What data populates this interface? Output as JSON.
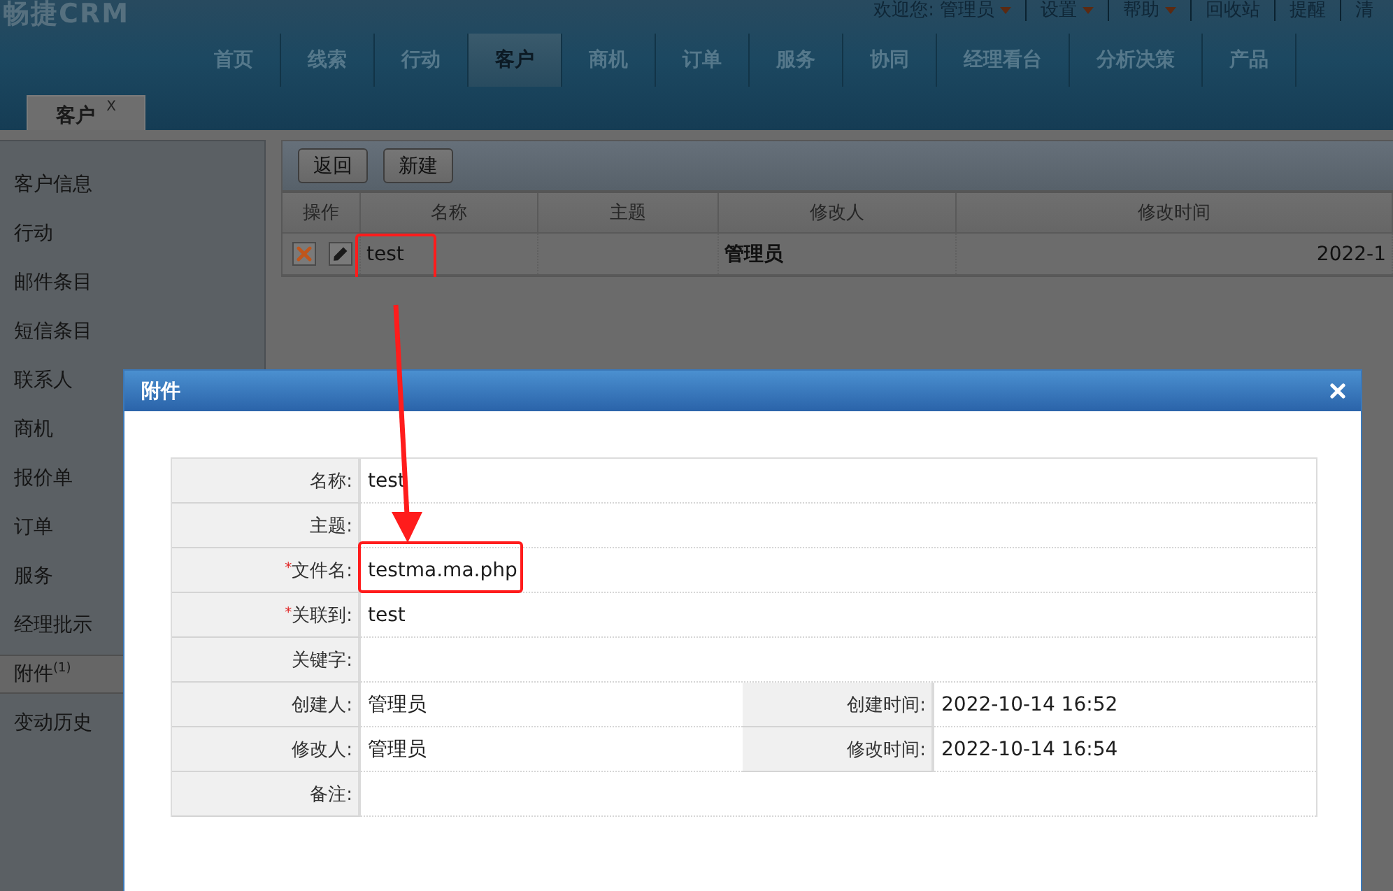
{
  "header": {
    "logo": "畅捷CRM",
    "welcome": "欢迎您:",
    "links": [
      {
        "label": "管理员",
        "dropdown": true
      },
      {
        "label": "设置",
        "dropdown": true
      },
      {
        "label": "帮助",
        "dropdown": true
      },
      {
        "label": "回收站",
        "dropdown": false
      },
      {
        "label": "提醒",
        "dropdown": false
      },
      {
        "label": "清",
        "dropdown": false
      }
    ]
  },
  "nav": [
    {
      "label": "首页",
      "selected": false
    },
    {
      "label": "线索",
      "selected": false
    },
    {
      "label": "行动",
      "selected": false
    },
    {
      "label": "客户",
      "selected": true
    },
    {
      "label": "商机",
      "selected": false
    },
    {
      "label": "订单",
      "selected": false
    },
    {
      "label": "服务",
      "selected": false
    },
    {
      "label": "协同",
      "selected": false
    },
    {
      "label": "经理看台",
      "selected": false
    },
    {
      "label": "分析决策",
      "selected": false
    },
    {
      "label": "产品",
      "selected": false
    }
  ],
  "page_tabs": [
    {
      "label": "客户",
      "close": "X",
      "selected": true
    }
  ],
  "sidebar": {
    "items": [
      {
        "label": "客户信息",
        "selected": false
      },
      {
        "label": "行动",
        "selected": false
      },
      {
        "label": "邮件条目",
        "selected": false
      },
      {
        "label": "短信条目",
        "selected": false
      },
      {
        "label": "联系人",
        "selected": false
      },
      {
        "label": "商机",
        "selected": false
      },
      {
        "label": "报价单",
        "selected": false
      },
      {
        "label": "订单",
        "selected": false
      },
      {
        "label": "服务",
        "selected": false
      },
      {
        "label": "经理批示",
        "selected": false
      },
      {
        "label": "附件$^{(1)}$",
        "selected": true
      },
      {
        "label": "变动历史",
        "selected": false
      }
    ]
  },
  "toolbar": {
    "buttons": [
      "返回",
      "新建"
    ]
  },
  "table": {
    "columns": [
      "操作",
      "名称",
      "主题",
      "修改人",
      "修改时间"
    ],
    "rows": [
      {
        "actions": [
          {
            "kind": "delete"
          },
          {
            "kind": "edit"
          }
        ],
        "name": "test",
        "name_highlighted": true,
        "modifier": "管理员",
        "modified_time": "2022-1"
      }
    ]
  },
  "dialog": {
    "title": "附件",
    "fields": [
      {
        "label": "名称:",
        "value": "test",
        "highlighted": false
      },
      {
        "label": "主题:",
        "highlighted": false
      },
      {
        "required_mark": "*",
        "label": "文件名:",
        "value": "testma.ma.php",
        "highlighted": true
      },
      {
        "required_mark": "*",
        "label": "关联到:",
        "value": "test",
        "highlighted": false
      },
      {
        "label": "关键字:",
        "highlighted": false
      },
      {
        "label": "创建人:",
        "value": "管理员",
        "highlighted": false,
        "side": {
          "label": "创建时间:",
          "value": "2022-10-14 16:52"
        }
      },
      {
        "label": "修改人:",
        "value": "管理员",
        "highlighted": false,
        "side": {
          "label": "修改时间:",
          "value": "2022-10-14 16:54"
        }
      },
      {
        "label": "备注:",
        "highlighted": false
      }
    ]
  }
}
